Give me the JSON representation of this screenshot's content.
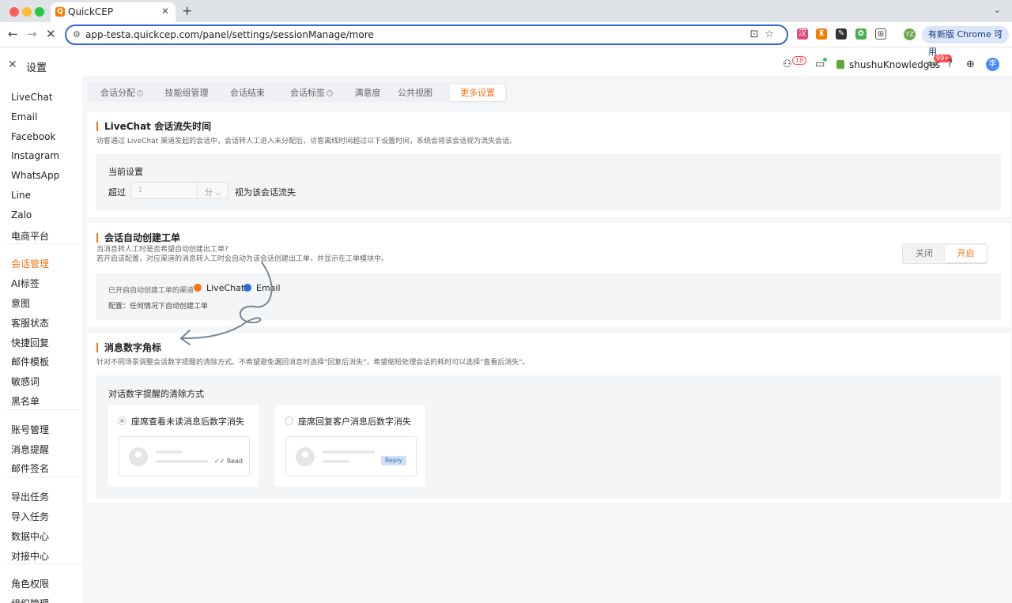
{
  "browser": {
    "tab_title": "QuickCEP",
    "tab_icon": "Q",
    "url": "app-testa.quickcep.com/panel/settings/sessionManage/more",
    "profile": "YZ",
    "update_label": "有新版 Chrome 可用"
  },
  "app": {
    "title": "设置",
    "agent_badge": "18",
    "notify_badge": "99+",
    "workspace": "shushuKnowledges",
    "user_initial": "李",
    "colors": {
      "accent": "#f5761a",
      "panel": "#f4f5f7",
      "bg": "#f5f6f8"
    }
  },
  "sidebar": {
    "groups": [
      [
        "LiveChat",
        "Email",
        "Facebook",
        "Instagram",
        "WhatsApp",
        "Line",
        "Zalo",
        "电商平台"
      ],
      [
        "会话管理",
        "AI标签",
        "意图",
        "客服状态",
        "快捷回复",
        "邮件模板",
        "敏感词",
        "黑名单"
      ],
      [
        "账号管理",
        "消息提醒",
        "邮件签名"
      ],
      [
        "导出任务",
        "导入任务",
        "数据中心",
        "对接中心"
      ],
      [
        "角色权限",
        "组织管理"
      ]
    ],
    "active": "会话管理"
  },
  "tabs": [
    "会话分配",
    "技能组管理",
    "会话结束",
    "会话标签",
    "满意度",
    "公共视图",
    "更多设置"
  ],
  "active_tab": "更多设置",
  "section1": {
    "title": "LiveChat 会话流失时间",
    "desc": "访客通过 LiveChat 渠道发起的会话中，会话转人工进入未分配后，访客离线时间超过以下设置时间，系统会将该会话视为流失会话。",
    "panel_title": "当前设置",
    "prefix": "超过",
    "value": "1",
    "unit": "分",
    "suffix": "视为该会话流失"
  },
  "section2": {
    "title": "会话自动创建工单",
    "desc1": "当消息转人工时是否希望自动创建出工单?",
    "desc2": "若开启该配置，对应渠道的消息转人工时会自动为该会话创建出工单，并显示在工单模块中。",
    "toggle_off": "关闭",
    "toggle_on": "开启",
    "channels_label": "已开启自动创建工单的渠道",
    "channel1": "LiveChat",
    "channel2": "Email",
    "config": "配置：任何情况下自动创建工单"
  },
  "section3": {
    "title": "消息数字角标",
    "desc": "针对不同场景调整会话数字提醒的清除方式。不希望避免漏回消息时选择\"回复后消失\"，希望缩短处理会话的耗时可以选择\"查看后消失\"。",
    "panel_title": "对话数字提醒的清除方式",
    "option1": "座席查看未读消息后数字消失",
    "option1_tag": "Read",
    "option2": "座席回复客户消息后数字消失",
    "option2_tag": "Reply"
  }
}
